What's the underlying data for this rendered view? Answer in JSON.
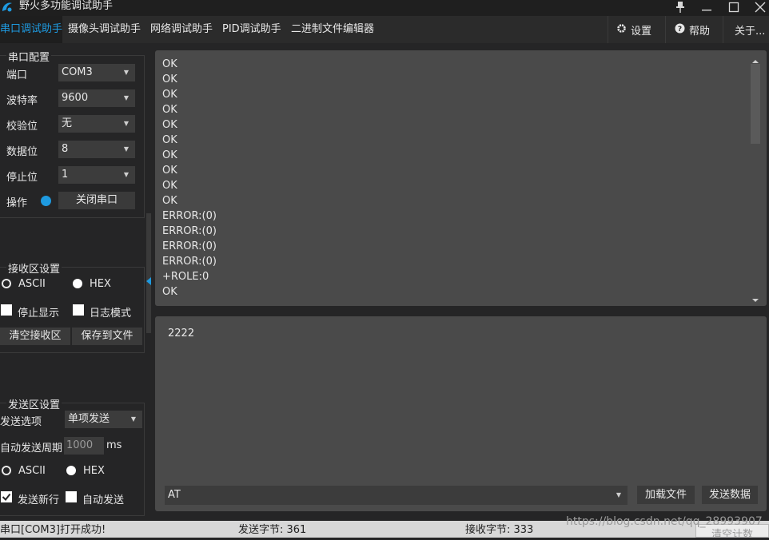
{
  "window": {
    "title": "野火多功能调试助手"
  },
  "tabs": [
    {
      "label": "串口调试助手",
      "active": true
    },
    {
      "label": "摄像头调试助手",
      "active": false
    },
    {
      "label": "网络调试助手",
      "active": false
    },
    {
      "label": "PID调试助手",
      "active": false
    },
    {
      "label": "二进制文件编辑器",
      "active": false
    }
  ],
  "top_buttons": {
    "settings": "设置",
    "help": "帮助",
    "about": "关于..."
  },
  "serial_config": {
    "title": "串口配置",
    "port_label": "端口",
    "port_value": "COM3",
    "baud_label": "波特率",
    "baud_value": "9600",
    "parity_label": "校验位",
    "parity_value": "无",
    "databits_label": "数据位",
    "databits_value": "8",
    "stopbits_label": "停止位",
    "stopbits_value": "1",
    "operation_label": "操作",
    "close_button": "关闭串口",
    "status_color": "#1e9ae0"
  },
  "receive_settings": {
    "title": "接收区设置",
    "ascii_label": "ASCII",
    "hex_label": "HEX",
    "mode": "HEX",
    "stop_display_label": "停止显示",
    "stop_display_checked": false,
    "log_mode_label": "日志模式",
    "log_mode_checked": false,
    "clear_button": "清空接收区",
    "save_button": "保存到文件"
  },
  "send_settings": {
    "title": "发送区设置",
    "option_label": "发送选项",
    "option_value": "单项发送",
    "period_label": "自动发送周期",
    "period_value": "1000",
    "period_unit": "ms",
    "ascii_label": "ASCII",
    "hex_label": "HEX",
    "mode": "HEX",
    "newline_label": "发送新行",
    "newline_checked": true,
    "auto_send_label": "自动发送",
    "auto_send_checked": false
  },
  "receive_lines": [
    "OK",
    "OK",
    "OK",
    "OK",
    "OK",
    "OK",
    "OK",
    "OK",
    "OK",
    "OK",
    "ERROR:(0)",
    "ERROR:(0)",
    "ERROR:(0)",
    "ERROR:(0)",
    "+ROLE:0",
    "OK"
  ],
  "send_area": {
    "text": "2222",
    "command_value": "AT",
    "load_file_button": "加载文件",
    "send_button": "发送数据"
  },
  "status": {
    "message": "串口[COM3]打开成功!",
    "sent_label": "发送字节: 361",
    "recv_label": "接收字节: 333",
    "clear_count_button": "清空计数",
    "watermark": "https://blog.csdn.net/qq_28993907"
  }
}
